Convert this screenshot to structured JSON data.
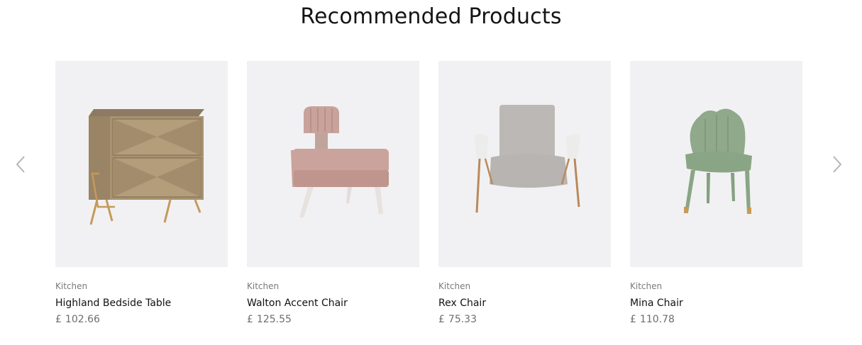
{
  "section": {
    "title": "Recommended Products"
  },
  "carousel": {
    "prev_icon": "chevron-left-icon",
    "next_icon": "chevron-right-icon"
  },
  "products": [
    {
      "category": "Kitchen",
      "name": "Highland Bedside Table",
      "currency": "£",
      "price": "102.66",
      "image": "bedside-table-image"
    },
    {
      "category": "Kitchen",
      "name": "Walton Accent Chair",
      "currency": "£",
      "price": "125.55",
      "image": "accent-chair-image"
    },
    {
      "category": "Kitchen",
      "name": "Rex Chair",
      "currency": "£",
      "price": "75.33",
      "image": "lounge-chair-image"
    },
    {
      "category": "Kitchen",
      "name": "Mina Chair",
      "currency": "£",
      "price": "110.78",
      "image": "dining-chair-image"
    }
  ],
  "colors": {
    "card_bg": "#f1f1f3",
    "title": "#141414",
    "muted": "#7a7a7a"
  }
}
